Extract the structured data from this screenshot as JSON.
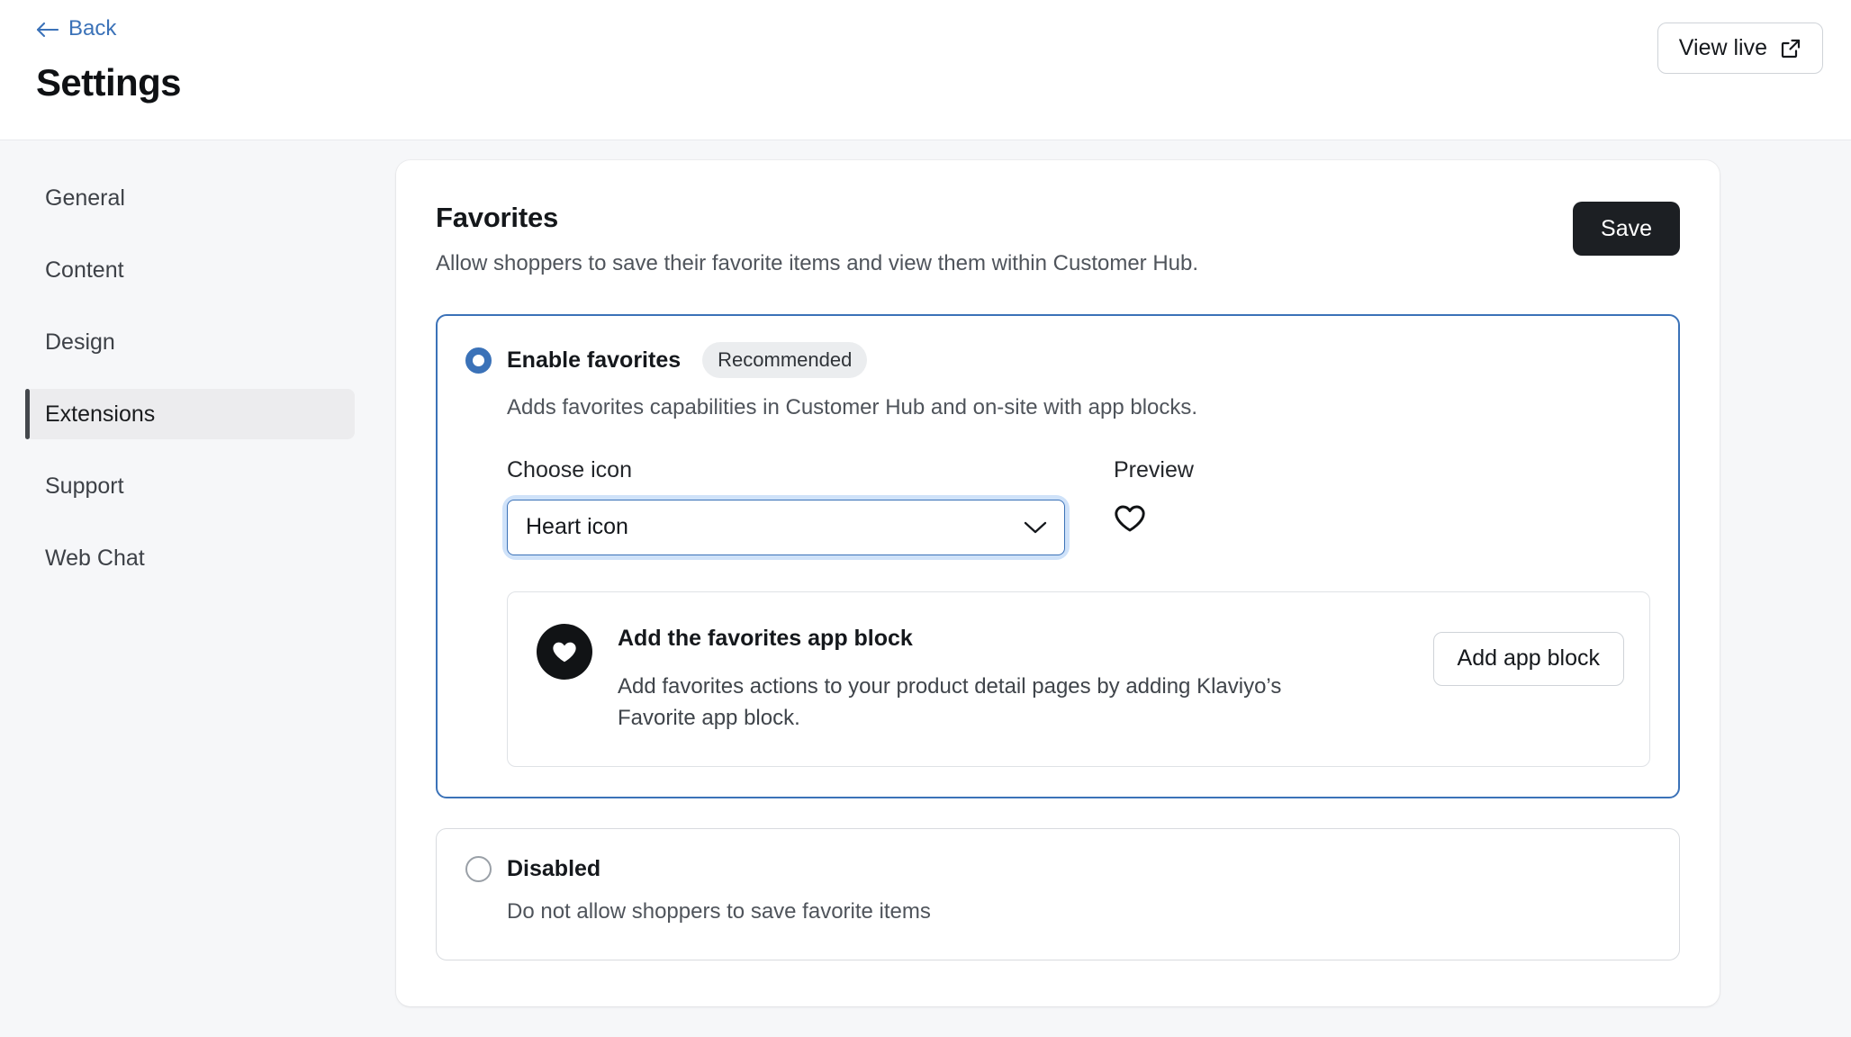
{
  "header": {
    "back_label": "Back",
    "back_icon": "arrow-left-icon",
    "title": "Settings",
    "view_live_label": "View live",
    "view_live_icon": "external-link-icon"
  },
  "sidebar": {
    "items": [
      {
        "label": "General",
        "active": false
      },
      {
        "label": "Content",
        "active": false
      },
      {
        "label": "Design",
        "active": false
      },
      {
        "label": "Extensions",
        "active": true
      },
      {
        "label": "Support",
        "active": false
      },
      {
        "label": "Web Chat",
        "active": false
      }
    ]
  },
  "main": {
    "title": "Favorites",
    "subtitle": "Allow shoppers to save their favorite items and view them within Customer Hub.",
    "save_label": "Save",
    "options": [
      {
        "label": "Enable favorites",
        "badge": "Recommended",
        "description": "Adds favorites capabilities in Customer Hub and on-site with app blocks.",
        "selected": true
      },
      {
        "label": "Disabled",
        "description": "Do not allow shoppers to save favorite items",
        "selected": false
      }
    ],
    "icon_chooser": {
      "choose_label": "Choose icon",
      "selected_value": "Heart icon",
      "chevron_icon": "chevron-down-icon",
      "preview_label": "Preview",
      "preview_icon": "heart-outline-icon"
    },
    "app_block": {
      "icon": "heart-filled-circle-icon",
      "title": "Add the favorites app block",
      "description": "Add favorites actions to your product detail pages by adding Klaviyo’s Favorite app block.",
      "button_label": "Add app block"
    }
  },
  "colors": {
    "accent_blue": "#3b72b8",
    "focus_ring": "#cfe2f9",
    "page_bg": "#f6f7f9",
    "save_btn_bg": "#1c1f23",
    "badge_bg": "#ebedef"
  }
}
